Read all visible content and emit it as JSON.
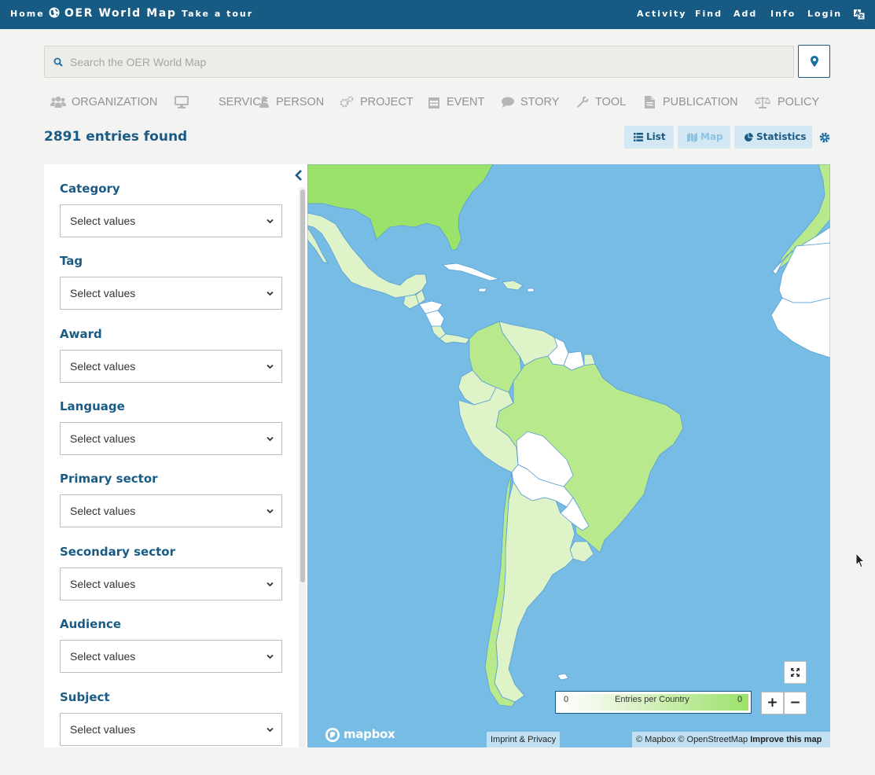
{
  "nav": {
    "home": "Home",
    "brand": "OER World Map",
    "tour": "Take a tour",
    "activity": "Activity",
    "find": "Find",
    "add": "Add",
    "info": "Info",
    "login": "Login"
  },
  "search": {
    "placeholder": "Search the OER World Map"
  },
  "types": [
    "ORGANIZATION",
    "SERVICE",
    "PERSON",
    "PROJECT",
    "EVENT",
    "STORY",
    "TOOL",
    "PUBLICATION",
    "POLICY"
  ],
  "results": {
    "count": "2891 entries found"
  },
  "views": {
    "list": "List",
    "map": "Map",
    "statistics": "Statistics"
  },
  "filters": [
    {
      "label": "Category",
      "placeholder": "Select values"
    },
    {
      "label": "Tag",
      "placeholder": "Select values"
    },
    {
      "label": "Award",
      "placeholder": "Select values"
    },
    {
      "label": "Language",
      "placeholder": "Select values"
    },
    {
      "label": "Primary sector",
      "placeholder": "Select values"
    },
    {
      "label": "Secondary sector",
      "placeholder": "Select values"
    },
    {
      "label": "Audience",
      "placeholder": "Select values"
    },
    {
      "label": "Subject",
      "placeholder": "Select values"
    }
  ],
  "map": {
    "legend_min": "0",
    "legend_label": "Entries per Country",
    "legend_max": "0",
    "zoom_in": "+",
    "zoom_out": "−",
    "logo": "mapbox",
    "imprint": "Imprint & Privacy",
    "attribution": "© Mapbox © OpenStreetMap",
    "improve": "Improve this map"
  },
  "colors": {
    "topbar": "#175b85",
    "ocean": "#77bce4",
    "land_high": "#9be26a",
    "land_mid": "#b8e98d",
    "land_low": "#dff3c9",
    "land_none": "#ffffff",
    "accent": "#1a5b85"
  }
}
